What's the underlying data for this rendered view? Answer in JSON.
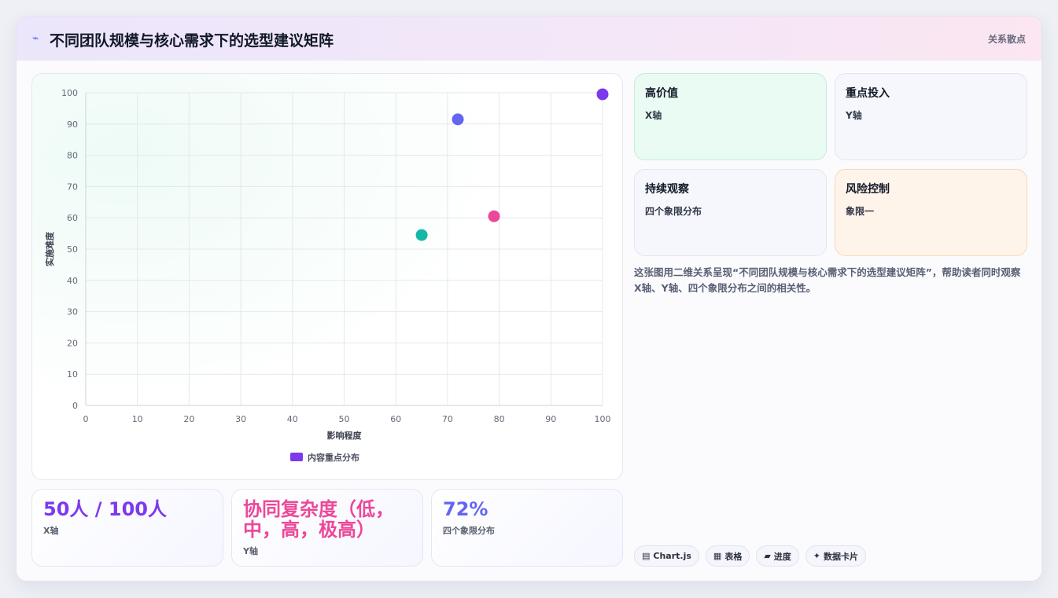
{
  "header": {
    "icon": "lightning-icon",
    "title": "不同团队规模与核心需求下的选型建议矩阵",
    "tag": "关系散点"
  },
  "chart_data": {
    "type": "scatter",
    "xlabel": "影响程度",
    "ylabel": "实施难度",
    "xlim": [
      0,
      100
    ],
    "ylim": [
      0,
      100
    ],
    "xticks": [
      "0",
      "10",
      "20",
      "30",
      "40",
      "50",
      "60",
      "70",
      "80",
      "90",
      "100"
    ],
    "yticks": [
      "0",
      "10",
      "20",
      "30",
      "40",
      "50",
      "60",
      "70",
      "80",
      "90",
      "100"
    ],
    "grid": true,
    "legend_position": "bottom",
    "series": [
      {
        "name": "内容重点分布",
        "color": "#7c3aed",
        "points": [
          {
            "x": 65,
            "y": 54.5,
            "color": "#14b8a6"
          },
          {
            "x": 72,
            "y": 91.5,
            "color": "#6366f1"
          },
          {
            "x": 79,
            "y": 60.5,
            "color": "#ec4899"
          },
          {
            "x": 100,
            "y": 99.5,
            "color": "#7c3aed"
          }
        ]
      }
    ]
  },
  "stats": [
    {
      "value": "50人 / 100人",
      "label": "X轴",
      "color": "#7c3aed"
    },
    {
      "value": "协同复杂度（低，中，高，极高）",
      "label": "Y轴",
      "color": "#ec4899"
    },
    {
      "value": "72%",
      "label": "四个象限分布",
      "color": "#6366f1"
    }
  ],
  "quadrants": [
    {
      "title": "高价值",
      "sub": "X轴",
      "bg": "#eafbf3",
      "border": "#bfeed8"
    },
    {
      "title": "重点投入",
      "sub": "Y轴",
      "bg": "#f6f7fc",
      "border": "#e4e4f0"
    },
    {
      "title": "持续观察",
      "sub": "四个象限分布",
      "bg": "#f6f7fc",
      "border": "#e4e4f0"
    },
    {
      "title": "风险控制",
      "sub": "象限一",
      "bg": "#fff4ea",
      "border": "#f7d9b8"
    }
  ],
  "description": "这张图用二维关系呈现“不同团队规模与核心需求下的选型建议矩阵”，帮助读者同时观察X轴、Y轴、四个象限分布之间的相关性。",
  "chips": [
    {
      "icon": "chart-icon",
      "glyph": "▤",
      "label": "Chart.js"
    },
    {
      "icon": "table-icon",
      "glyph": "▦",
      "label": "表格"
    },
    {
      "icon": "progress-icon",
      "glyph": "▰",
      "label": "进度"
    },
    {
      "icon": "sparkle-icon",
      "glyph": "✦",
      "label": "数据卡片"
    }
  ]
}
